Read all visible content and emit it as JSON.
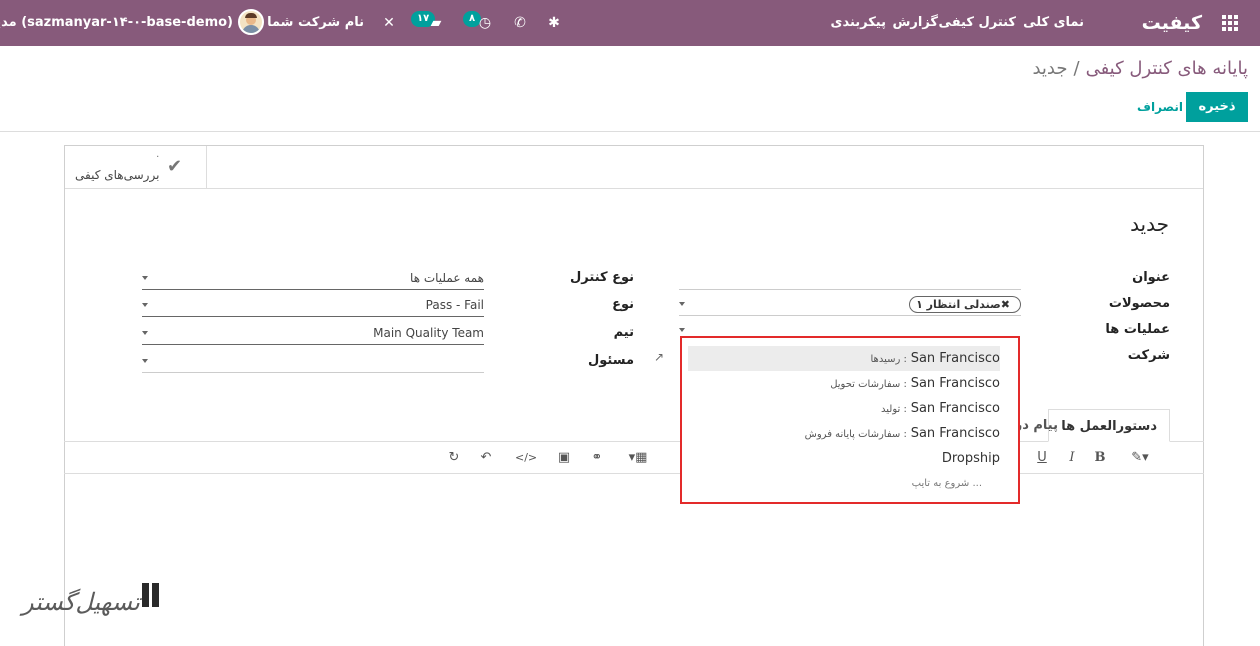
{
  "topbar": {
    "brand": "کیفیت",
    "menu": [
      "نمای کلی",
      "کنترل کیفی",
      "گزارش",
      "پیکربندی"
    ],
    "activities_badge": "۸",
    "messages_badge": "۱۷",
    "company": "نام شرکت شما",
    "user": "مدیر سیستم",
    "database": "(sazmanyar-۱۴-۰-base-demo)",
    "color": "#875a7b"
  },
  "breadcrumb": {
    "parent": "پایانه های کنترل کیفی",
    "separator": "/",
    "current": "جدید"
  },
  "buttons": {
    "save": "ذخیره",
    "discard": "انصراف"
  },
  "smart_button": {
    "count": "۰",
    "label": "بررسی‌های کیفی"
  },
  "record": {
    "title": "جدید",
    "labels": {
      "title": "عنوان",
      "products": "محصولات",
      "operations": "عملیات ها",
      "company": "شرکت",
      "control_type": "نوع کنترل",
      "type": "نوع",
      "team": "تیم",
      "responsible": "مسئول"
    },
    "values": {
      "title": "",
      "product_tag": "صندلی انتظار ۱",
      "control_type": "همه عملیات ها",
      "type": "Pass - Fail",
      "team": "Main Quality Team",
      "responsible": ""
    }
  },
  "dropdown": {
    "items": [
      {
        "main": "San Francisco",
        "sub": "رسیدها",
        "active": true
      },
      {
        "main": "San Francisco",
        "sub": "سفارشات تحویل",
        "active": false
      },
      {
        "main": "San Francisco",
        "sub": "تولید",
        "active": false
      },
      {
        "main": "San Francisco",
        "sub": "سفارشات پایانه فروش",
        "active": false
      },
      {
        "main": "Dropship",
        "sub": "",
        "active": false
      }
    ],
    "hint": "شروع به تایپ ..."
  },
  "tabs": {
    "instructions": "دستورالعمل ها",
    "message": "پیام در"
  },
  "toolbar": {
    "bold": "B",
    "italic": "I",
    "underline": "U"
  },
  "watermark": {
    "text": "تسهیل‌گستر"
  },
  "icons": [
    "apps-icon",
    "bug-icon",
    "phone-icon",
    "clock-icon",
    "chat-icon",
    "tools-icon",
    "check-icon",
    "external-link-icon",
    "table-icon",
    "link-icon",
    "image-icon",
    "code-icon",
    "undo-icon",
    "redo-icon",
    "magic-icon"
  ]
}
